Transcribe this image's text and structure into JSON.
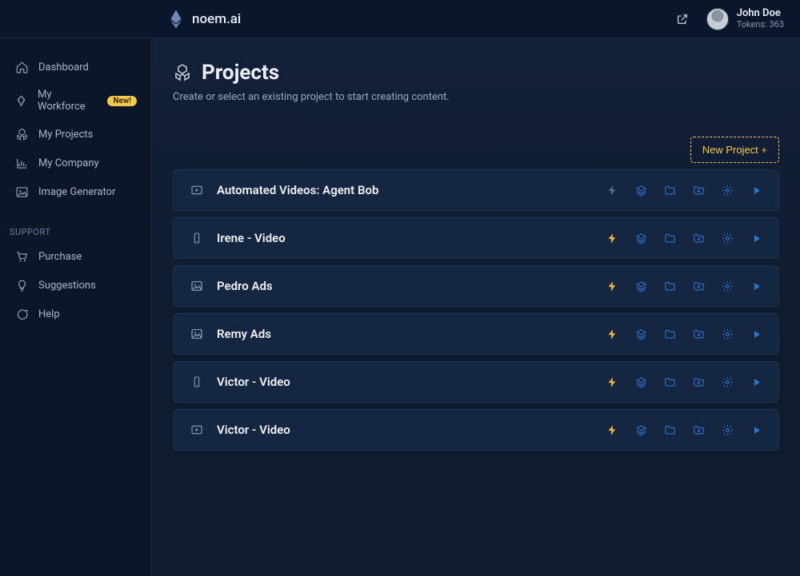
{
  "header": {
    "brand": "noem.ai",
    "user_name": "John Doe",
    "user_tokens": "Tokens: 363"
  },
  "sidebar": {
    "items": [
      {
        "label": "Dashboard",
        "icon": "home"
      },
      {
        "label": "My Workforce",
        "icon": "diamond",
        "badge": "New!"
      },
      {
        "label": "My Projects",
        "icon": "cubes"
      },
      {
        "label": "My Company",
        "icon": "chart"
      },
      {
        "label": "Image Generator",
        "icon": "image"
      }
    ],
    "support_heading": "SUPPORT",
    "support": [
      {
        "label": "Purchase",
        "icon": "cart"
      },
      {
        "label": "Suggestions",
        "icon": "bulb"
      },
      {
        "label": "Help",
        "icon": "chat"
      }
    ]
  },
  "page": {
    "title": "Projects",
    "subtitle": "Create or select an existing project to start creating content.",
    "new_button": "New Project +"
  },
  "projects": [
    {
      "name": "Automated Videos: Agent Bob",
      "type": "video",
      "lightning": "muted"
    },
    {
      "name": "Irene - Video",
      "type": "phone",
      "lightning": "gold"
    },
    {
      "name": "Pedro Ads",
      "type": "image",
      "lightning": "gold"
    },
    {
      "name": "Remy Ads",
      "type": "image",
      "lightning": "gold"
    },
    {
      "name": "Victor - Video",
      "type": "phone",
      "lightning": "gold"
    },
    {
      "name": "Victor - Video",
      "type": "video",
      "lightning": "gold"
    }
  ],
  "action_icons": [
    "lightning",
    "layers",
    "folder",
    "folder-add",
    "gear",
    "play"
  ]
}
